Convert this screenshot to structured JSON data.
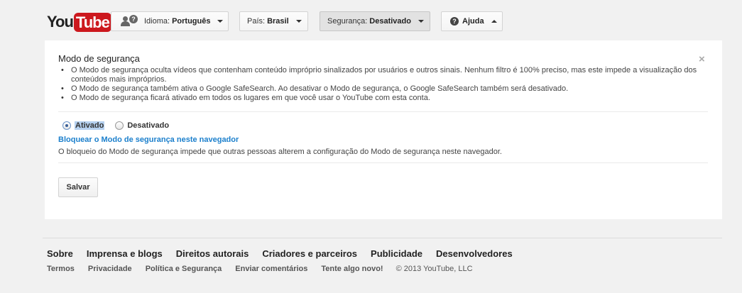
{
  "header": {
    "logo_you": "You",
    "logo_tube": "Tube",
    "language": {
      "label": "Idioma:",
      "value": "Português"
    },
    "country": {
      "label": "País:",
      "value": "Brasil"
    },
    "safety": {
      "label": "Segurança:",
      "value": "Desativado"
    },
    "help": {
      "label": "Ajuda"
    }
  },
  "panel": {
    "title": "Modo de segurança",
    "close": "×",
    "bullets": [
      "O Modo de segurança oculta vídeos que contenham conteúdo impróprio sinalizados por usuários e outros sinais. Nenhum filtro é 100% preciso, mas este impede a visualização dos conteúdos mais impróprios.",
      "O Modo de segurança também ativa o Google SafeSearch. Ao desativar o Modo de segurança, o Google SafeSearch também será desativado.",
      "O Modo de segurança ficará ativado em todos os lugares em que você usar o YouTube com esta conta."
    ],
    "options": [
      {
        "label": "Ativado",
        "selected": true
      },
      {
        "label": "Desativado",
        "selected": false
      }
    ],
    "lock_link": "Bloquear o Modo de segurança neste navegador",
    "lock_description": "O bloqueio do Modo de segurança impede que outras pessoas alterem a configuração do Modo de segurança neste navegador.",
    "save_label": "Salvar"
  },
  "footer": {
    "primary": [
      "Sobre",
      "Imprensa e blogs",
      "Direitos autorais",
      "Criadores e parceiros",
      "Publicidade",
      "Desenvolvedores"
    ],
    "secondary": [
      "Termos",
      "Privacidade",
      "Política e Segurança",
      "Enviar comentários",
      "Tente algo novo!"
    ],
    "copyright": "© 2013 YouTube, LLC"
  },
  "colors": {
    "accent_link": "#1b7fcc",
    "logo_red": "#cc181e"
  }
}
